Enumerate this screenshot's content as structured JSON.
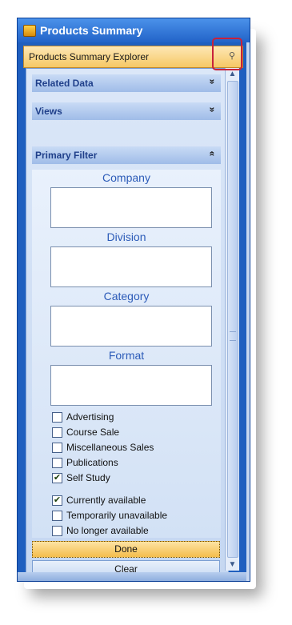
{
  "window": {
    "title": "Products Summary"
  },
  "explorer": {
    "header_label": "Products Summary Explorer"
  },
  "sections": {
    "related_data": "Related Data",
    "views": "Views",
    "primary_filter": "Primary Filter"
  },
  "icons": {
    "chevron_down": "»",
    "chevron_up": "«",
    "pin": "⚲",
    "scroll_up": "▲",
    "scroll_down": "▼"
  },
  "filters": {
    "company_label": "Company",
    "division_label": "Division",
    "category_label": "Category",
    "format_label": "Format"
  },
  "format_options": [
    {
      "label": "Advertising",
      "checked": false
    },
    {
      "label": "Course Sale",
      "checked": false
    },
    {
      "label": "Miscellaneous Sales",
      "checked": false
    },
    {
      "label": "Publications",
      "checked": false
    },
    {
      "label": "Self Study",
      "checked": true
    }
  ],
  "availability_options": [
    {
      "label": "Currently available",
      "checked": true
    },
    {
      "label": "Temporarily unavailable",
      "checked": false
    },
    {
      "label": "No longer available",
      "checked": false
    }
  ],
  "buttons": {
    "done": "Done",
    "clear": "Clear"
  },
  "colors": {
    "accent_highlight": "#c8213b",
    "title_bar": "#2263c8"
  }
}
